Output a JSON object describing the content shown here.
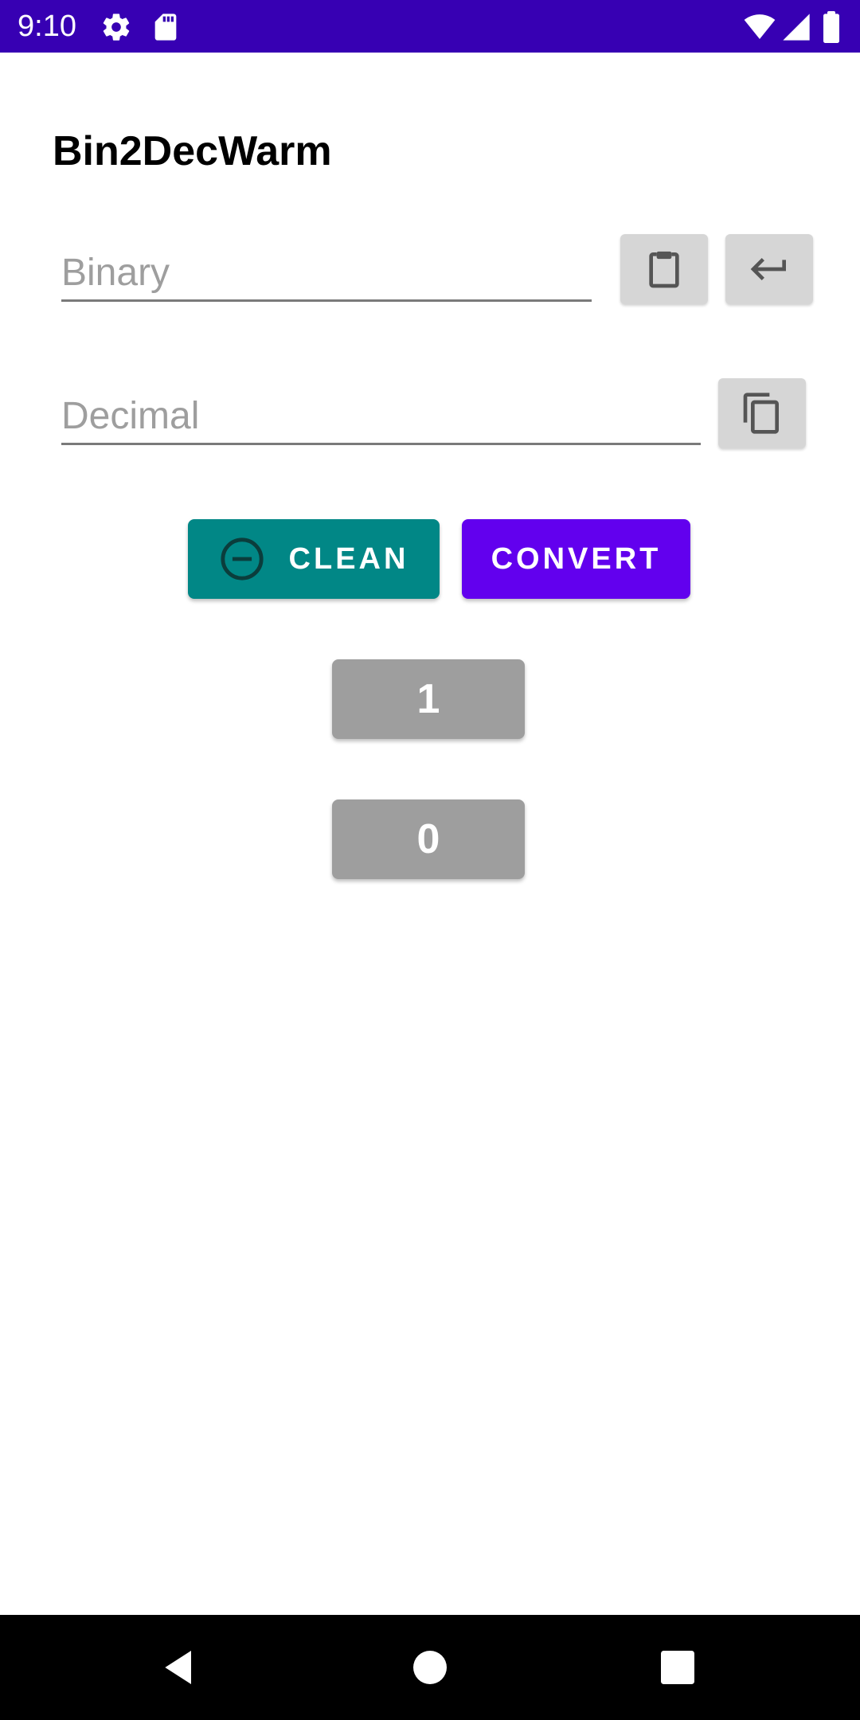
{
  "status_bar": {
    "time": "9:10",
    "color": "#3700b3",
    "icons": [
      "gear-icon",
      "sd-card-icon",
      "wifi-icon",
      "signal-icon",
      "battery-icon"
    ]
  },
  "app": {
    "title": "Bin2DecWarm"
  },
  "binary_field": {
    "value": "",
    "placeholder": "Binary"
  },
  "decimal_field": {
    "value": "",
    "placeholder": "Decimal"
  },
  "buttons": {
    "clean_label": "CLEAN",
    "convert_label": "CONVERT",
    "one_label": "1",
    "zero_label": "0"
  },
  "colors": {
    "clean": "#018786",
    "convert": "#6200ee",
    "digit": "#9e9e9e",
    "icon_button": "#d6d6d6"
  },
  "icons": {
    "paste": "clipboard-icon",
    "enter": "enter-arrow-icon",
    "copy": "copy-icon",
    "clean": "remove-circle-icon"
  },
  "nav_bar": {
    "icons": [
      "back-icon",
      "home-icon",
      "recents-icon"
    ]
  }
}
